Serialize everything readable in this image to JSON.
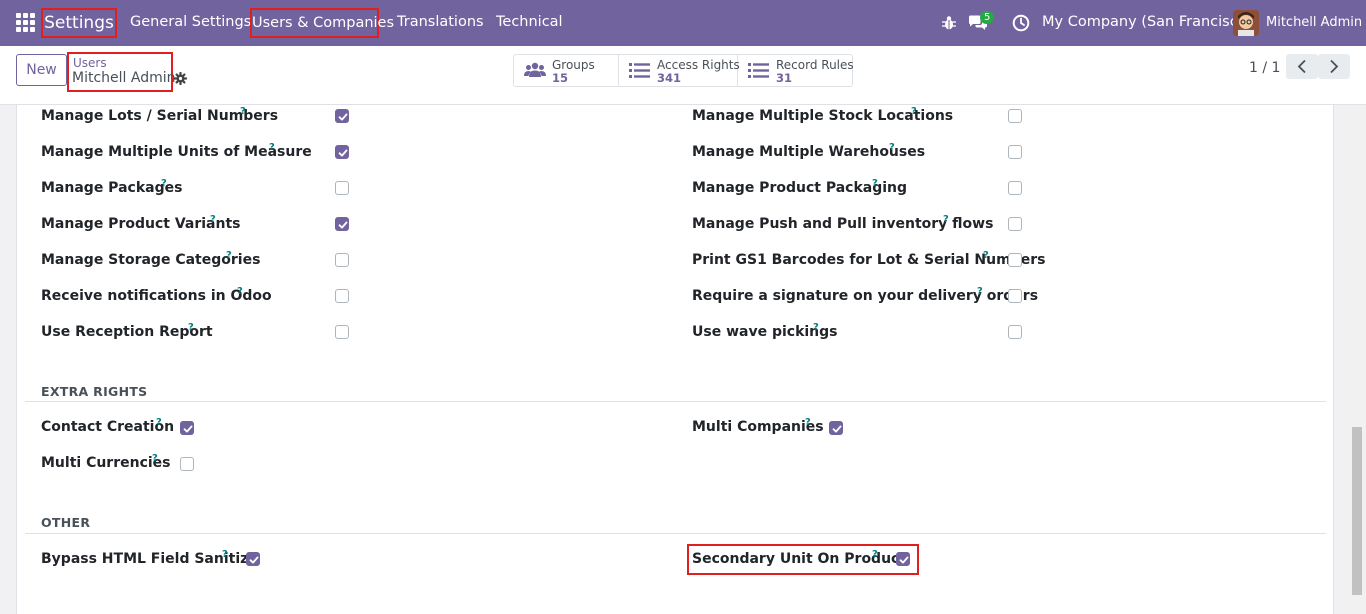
{
  "navbar": {
    "brand": "Settings",
    "menu": [
      "General Settings",
      "Users & Companies",
      "Translations",
      "Technical"
    ],
    "chat_badge": "5",
    "company": "My Company (San Francisco)",
    "user": "Mitchell Admin"
  },
  "control": {
    "new_label": "New",
    "breadcrumb_parent": "Users",
    "breadcrumb_current": "Mitchell Admin",
    "smart_buttons": [
      {
        "label": "Groups",
        "value": "15",
        "icon": "users-icon"
      },
      {
        "label": "Access Rights",
        "value": "341",
        "icon": "list-icon"
      },
      {
        "label": "Record Rules",
        "value": "31",
        "icon": "list-icon"
      }
    ],
    "pager": "1 / 1"
  },
  "help_mark": "?",
  "inventory_left": [
    {
      "label": "Manage Lots / Serial Numbers",
      "checked": true
    },
    {
      "label": "Manage Multiple Units of Measure",
      "checked": true
    },
    {
      "label": "Manage Packages",
      "checked": false
    },
    {
      "label": "Manage Product Variants",
      "checked": true
    },
    {
      "label": "Manage Storage Categories",
      "checked": false
    },
    {
      "label": "Receive notifications in Odoo",
      "checked": false
    },
    {
      "label": "Use Reception Report",
      "checked": false
    }
  ],
  "inventory_right": [
    {
      "label": "Manage Multiple Stock Locations",
      "checked": false
    },
    {
      "label": "Manage Multiple Warehouses",
      "checked": false
    },
    {
      "label": "Manage Product Packaging",
      "checked": false
    },
    {
      "label": "Manage Push and Pull inventory flows",
      "checked": false
    },
    {
      "label": "Print GS1 Barcodes for Lot & Serial Numbers",
      "checked": false
    },
    {
      "label": "Require a signature on your delivery orders",
      "checked": false
    },
    {
      "label": "Use wave pickings",
      "checked": false
    }
  ],
  "extra_rights": {
    "title": "EXTRA RIGHTS",
    "left": [
      {
        "label": "Contact Creation",
        "checked": true
      },
      {
        "label": "Multi Currencies",
        "checked": false
      }
    ],
    "right": [
      {
        "label": "Multi Companies",
        "checked": true
      }
    ]
  },
  "other": {
    "title": "OTHER",
    "left": [
      {
        "label": "Bypass HTML Field Sanitize",
        "checked": true
      }
    ],
    "right": [
      {
        "label": "Secondary Unit On Product",
        "checked": true
      }
    ]
  },
  "colors": {
    "brand": "#71639e",
    "help": "#017e84",
    "highlight": "#e02020"
  }
}
